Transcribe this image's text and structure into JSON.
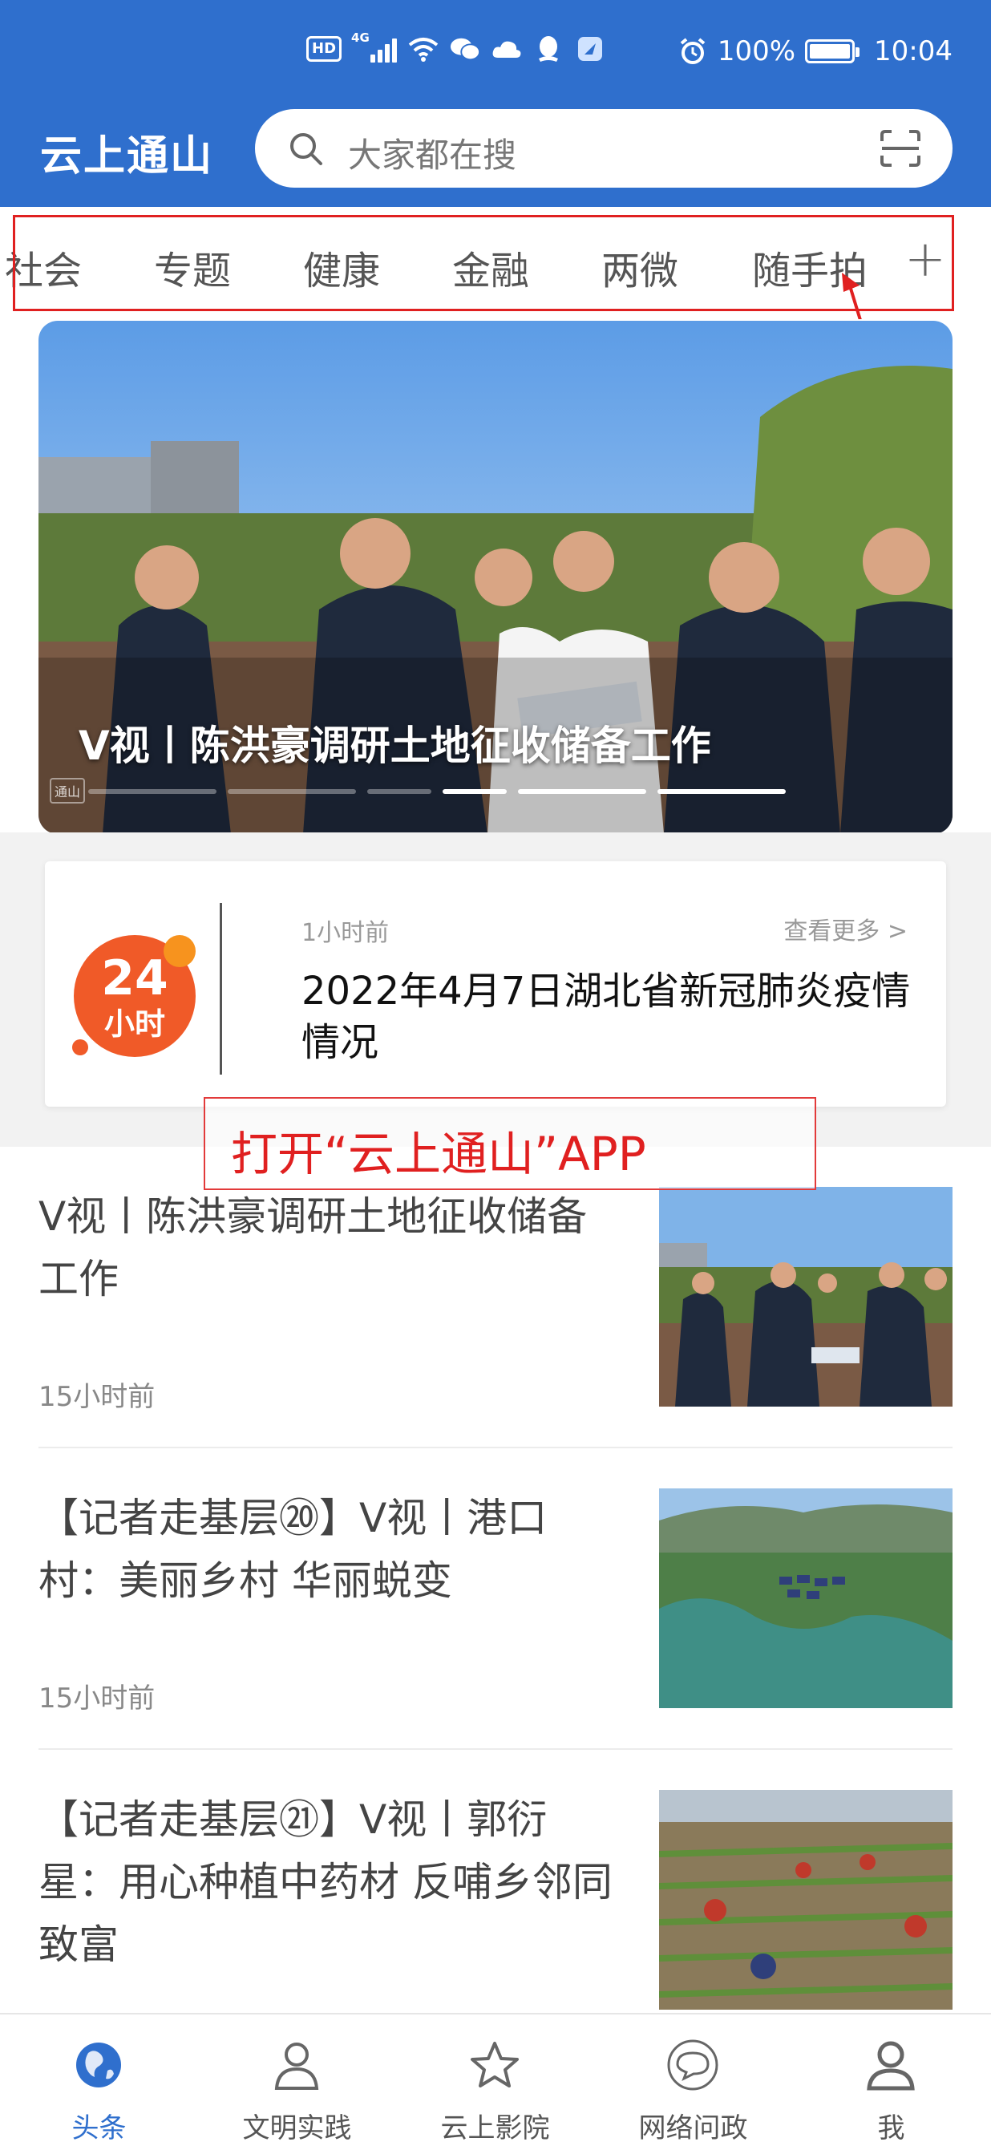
{
  "status_bar": {
    "hd": "HD",
    "network": "4G",
    "battery": "100%",
    "battery_level": 1.0,
    "time": "10:04"
  },
  "header": {
    "app_title": "云上通山",
    "search_placeholder": "大家都在搜"
  },
  "tabs": [
    "社会",
    "专题",
    "健康",
    "金融",
    "两微",
    "随手拍"
  ],
  "tabs_add": "+",
  "banner": {
    "caption": "V视丨陈洪豪调研土地征收储备工作",
    "logo_text": "通山",
    "slide_count": 6,
    "active_slide": 1
  },
  "card_24h": {
    "badge_top": "24",
    "badge_bottom": "小时",
    "time": "1小时前",
    "more": "查看更多 >",
    "title": "2022年4月7日湖北省新冠肺炎疫情情况"
  },
  "annotation": {
    "open_app": "打开“云上通山”APP"
  },
  "news": [
    {
      "title": "V视丨陈洪豪调研土地征收储备工作",
      "time": "15小时前"
    },
    {
      "title": "【记者走基层⑳】V视丨港口村：美丽乡村  华丽蜕变",
      "time": "15小时前"
    },
    {
      "title": "【记者走基层㉑】V视丨郭衍星：用心种植中药材  反哺乡邻同致富",
      "time": ""
    }
  ],
  "bottom_nav": [
    {
      "label": "头条",
      "icon": "globe-icon",
      "active": true
    },
    {
      "label": "文明实践",
      "icon": "person-icon",
      "active": false
    },
    {
      "label": "云上影院",
      "icon": "star-icon",
      "active": false
    },
    {
      "label": "网络问政",
      "icon": "chat-icon",
      "active": false
    },
    {
      "label": "我",
      "icon": "user-icon",
      "active": false
    }
  ],
  "colors": {
    "brand": "#2f6fcd",
    "annotation_red": "#e02020",
    "badge_orange": "#f05a28"
  }
}
